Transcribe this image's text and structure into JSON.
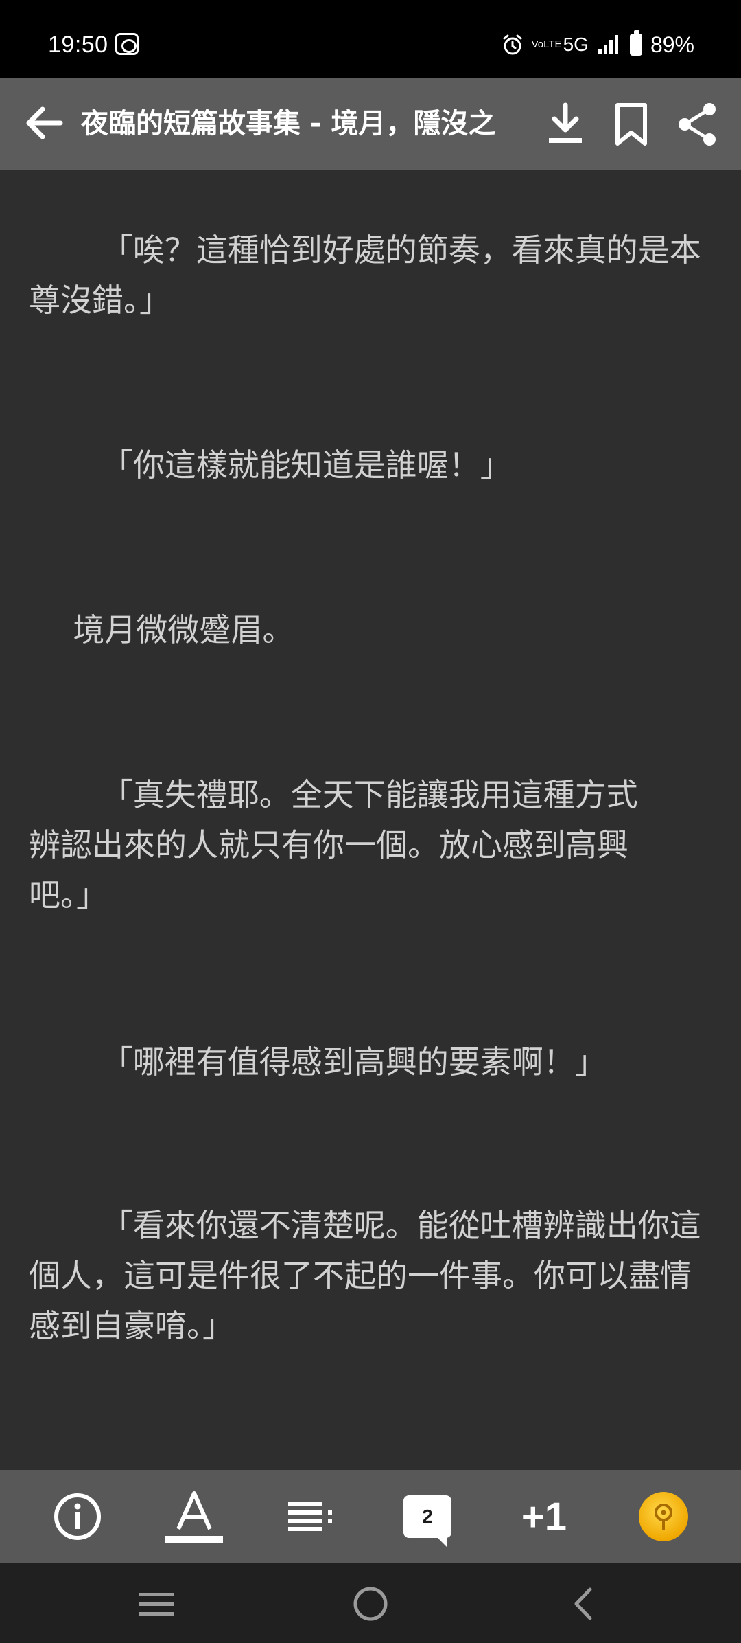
{
  "status_bar": {
    "time": "19:50",
    "network": "5G",
    "volte": "VoLTE",
    "battery": "89%"
  },
  "app_bar": {
    "title": "夜臨的短篇故事集 - 境月，隱沒之"
  },
  "content": {
    "paragraphs": [
      "「唉？這種恰到好處的節奏，看來真的是本尊沒錯。」",
      "「你這樣就能知道是誰喔！」",
      "境月微微蹙眉。",
      "「真失禮耶。全天下能讓我用這種方式辨認出來的人就只有你一個。放心感到高興吧。」",
      "「哪裡有值得感到高興的要素啊！」",
      "「看來你還不清楚呢。能從吐槽辨識出你這個人，這可是件很了不起的一件事。你可以盡情感到自豪唷。」"
    ]
  },
  "toolbar": {
    "comment_count": "2",
    "plus_one": "+1"
  },
  "colors": {
    "status_bar": "#000000",
    "app_bar": "#5c5c5c",
    "reader_bg": "#2e2e2e",
    "reader_text": "#d2d2d2",
    "toolbar": "#585858",
    "coin": "#f5b800"
  },
  "icons": {
    "back": "arrow-left-icon",
    "download": "download-icon",
    "bookmark": "bookmark-icon",
    "share": "share-icon",
    "info": "info-icon",
    "font": "font-settings-icon",
    "toc": "table-of-contents-icon",
    "comments": "comment-icon",
    "coin": "coin-icon"
  }
}
